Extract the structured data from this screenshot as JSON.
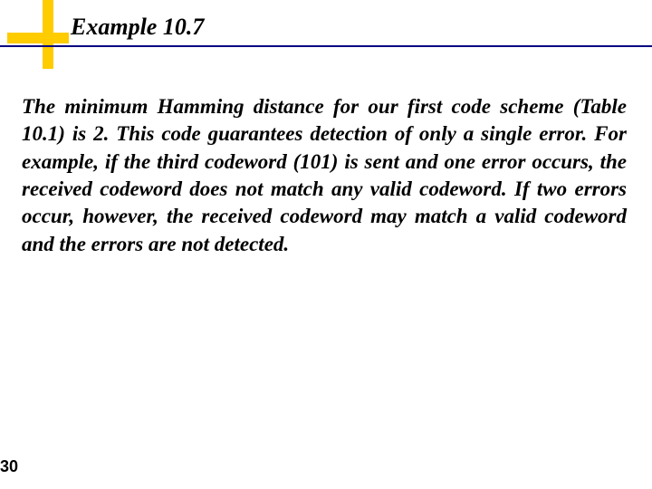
{
  "title": "Example 10.7",
  "body": "The minimum Hamming distance for our first code scheme (Table 10.1) is 2. This code guarantees detection of only a single error. For example, if the third codeword (101) is sent and one error occurs, the received codeword does not match any valid codeword. If two errors occur, however, the received codeword may match a valid codeword and the errors are not detected.",
  "page_number": "30"
}
